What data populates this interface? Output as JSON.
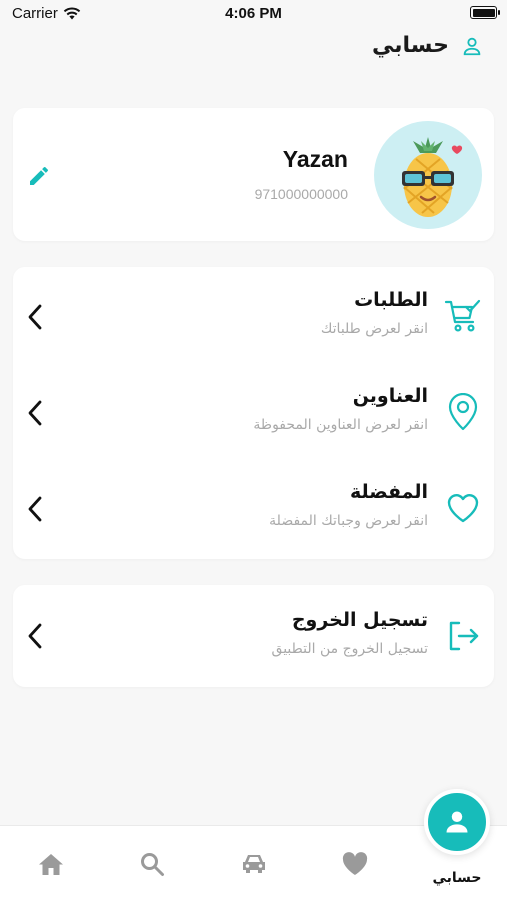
{
  "status_bar": {
    "carrier": "Carrier",
    "time": "4:06 PM"
  },
  "header": {
    "title": "حسابي",
    "icon": "user-icon"
  },
  "profile": {
    "name": "Yazan",
    "phone": "971000000000",
    "edit_icon": "pencil-icon"
  },
  "menu": {
    "items": [
      {
        "title": "الطلبات",
        "subtitle": "انقر لعرض طلباتك",
        "icon": "cart-check-icon"
      },
      {
        "title": "العناوين",
        "subtitle": "انقر لعرض العناوين المحفوظة",
        "icon": "location-pin-icon"
      },
      {
        "title": "المفضلة",
        "subtitle": "انقر لعرض وجباتك المفضلة",
        "icon": "heart-icon"
      }
    ]
  },
  "logout": {
    "title": "تسجيل الخروج",
    "subtitle": "تسجيل الخروج من التطبيق",
    "icon": "logout-icon"
  },
  "tabbar": {
    "items": [
      {
        "icon": "home-icon"
      },
      {
        "icon": "search-icon"
      },
      {
        "icon": "car-icon"
      },
      {
        "icon": "heart-icon"
      }
    ],
    "active": {
      "label": "حسابي",
      "icon": "user-icon"
    }
  },
  "colors": {
    "accent": "#17bcba",
    "icon_gray": "#9a9a9a",
    "background": "#f7f7f7"
  }
}
